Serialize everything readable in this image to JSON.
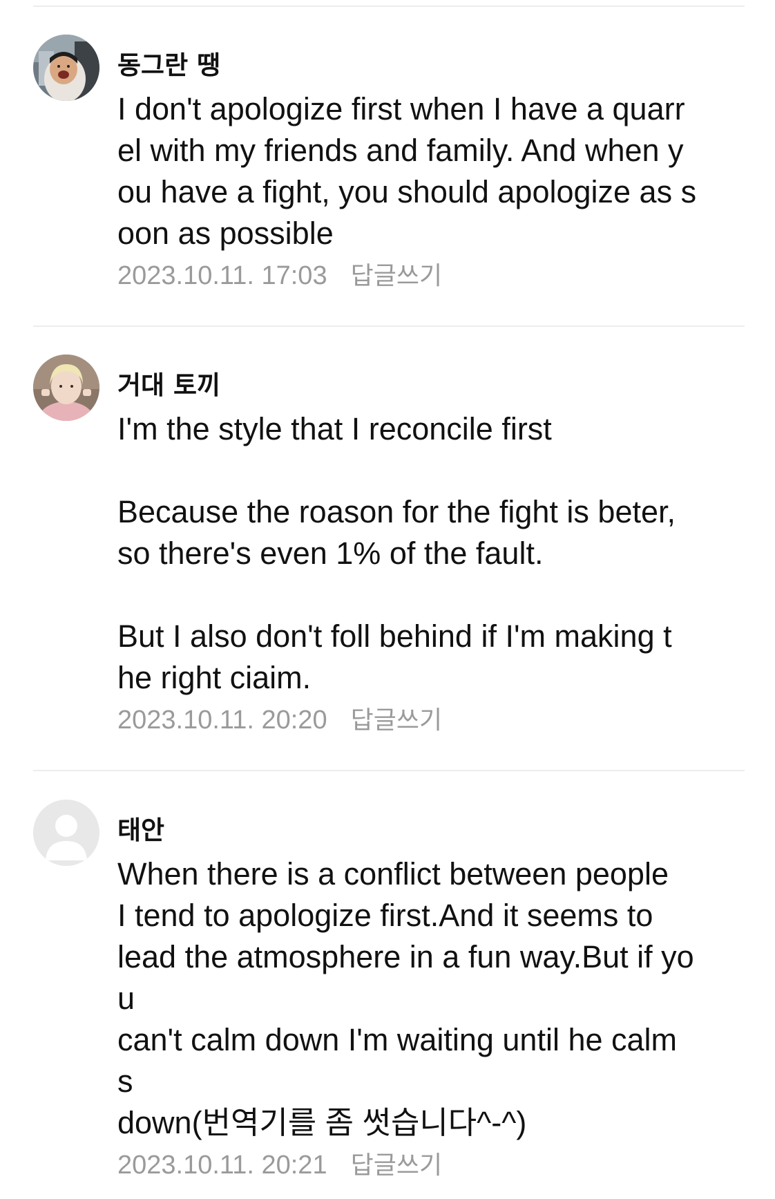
{
  "comments": [
    {
      "author": "동그란 땡",
      "avatar": "avatar-photo-person-grimace",
      "text": "I don't apologize first when I have a quarr\nel with my friends and family. And when y\nou have a fight, you should apologize as s\noon as possible",
      "date": "2023.10.11. 17:03",
      "reply_label": "답글쓰기"
    },
    {
      "author": "거대 토끼",
      "avatar": "avatar-photo-person-peace-sign",
      "text": "I'm the style that I reconcile first\n\nBecause the roason for the fight is beter,\nso there's even 1% of the fault.\n\nBut I also don't foll behind if I'm making t\nhe right ciaim.",
      "date": "2023.10.11. 20:20",
      "reply_label": "답글쓰기"
    },
    {
      "author": "태안",
      "avatar": "default-user-icon",
      "text": "When there is a conflict between people\nI tend to apologize first.And it seems to\nlead the atmosphere in a fun way.But if yo\nu\ncan't calm down I'm waiting until he calm\ns\ndown(번역기를 좀 썻습니다^-^)",
      "date": "2023.10.11. 20:21",
      "reply_label": "답글쓰기"
    }
  ],
  "colors": {
    "text": "#111111",
    "meta": "#9a9a9a",
    "divider": "#ececec",
    "default_avatar_bg": "#e8e8e8"
  }
}
